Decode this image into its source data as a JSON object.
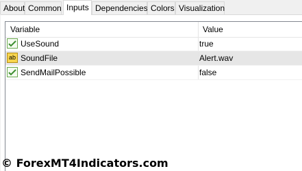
{
  "tabs": [
    "About",
    "Common",
    "Inputs",
    "Dependencies",
    "Colors",
    "Visualization"
  ],
  "table": {
    "headers": {
      "variable": "Variable",
      "value": "Value"
    },
    "rows": [
      {
        "name": "UseSound",
        "value": "true",
        "icon": "boolean-icon"
      },
      {
        "name": "SoundFile",
        "value": "Alert.wav",
        "icon": "string-ab-icon",
        "icon_text": "ab"
      },
      {
        "name": "SendMailPossible",
        "value": "false",
        "icon": "boolean-icon"
      }
    ]
  },
  "watermark": {
    "symbol": "©",
    "text": "ForexMT4Indicators.com"
  }
}
